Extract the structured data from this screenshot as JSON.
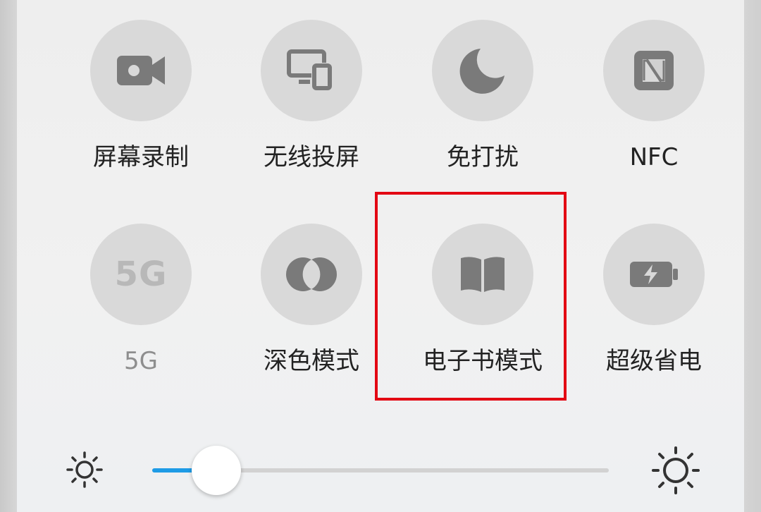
{
  "quick_settings": {
    "tiles": [
      {
        "id": "screen-record",
        "label": "屏幕录制",
        "icon": "video-camera-icon",
        "enabled": true
      },
      {
        "id": "wireless-projection",
        "label": "无线投屏",
        "icon": "screen-cast-icon",
        "enabled": true
      },
      {
        "id": "do-not-disturb",
        "label": "免打扰",
        "icon": "moon-icon",
        "enabled": true
      },
      {
        "id": "nfc",
        "label": "NFC",
        "icon": "nfc-icon",
        "enabled": true
      },
      {
        "id": "5g",
        "label": "5G",
        "icon_text": "5G",
        "icon": "5g-icon",
        "enabled": false
      },
      {
        "id": "dark-mode",
        "label": "深色模式",
        "icon": "dark-mode-icon",
        "enabled": true
      },
      {
        "id": "ebook-mode",
        "label": "电子书模式",
        "icon": "book-icon",
        "enabled": true,
        "highlighted": true
      },
      {
        "id": "super-power-saving",
        "label": "超级省电",
        "icon": "battery-charging-icon",
        "enabled": true
      }
    ]
  },
  "brightness": {
    "level_percent": 14,
    "low_icon": "sun-small-icon",
    "high_icon": "sun-large-icon",
    "fill_color": "#1e9be6"
  },
  "colors": {
    "tile_bg": "#d9d9d9",
    "icon": "#7a7a7a",
    "highlight_border": "#e30613"
  }
}
